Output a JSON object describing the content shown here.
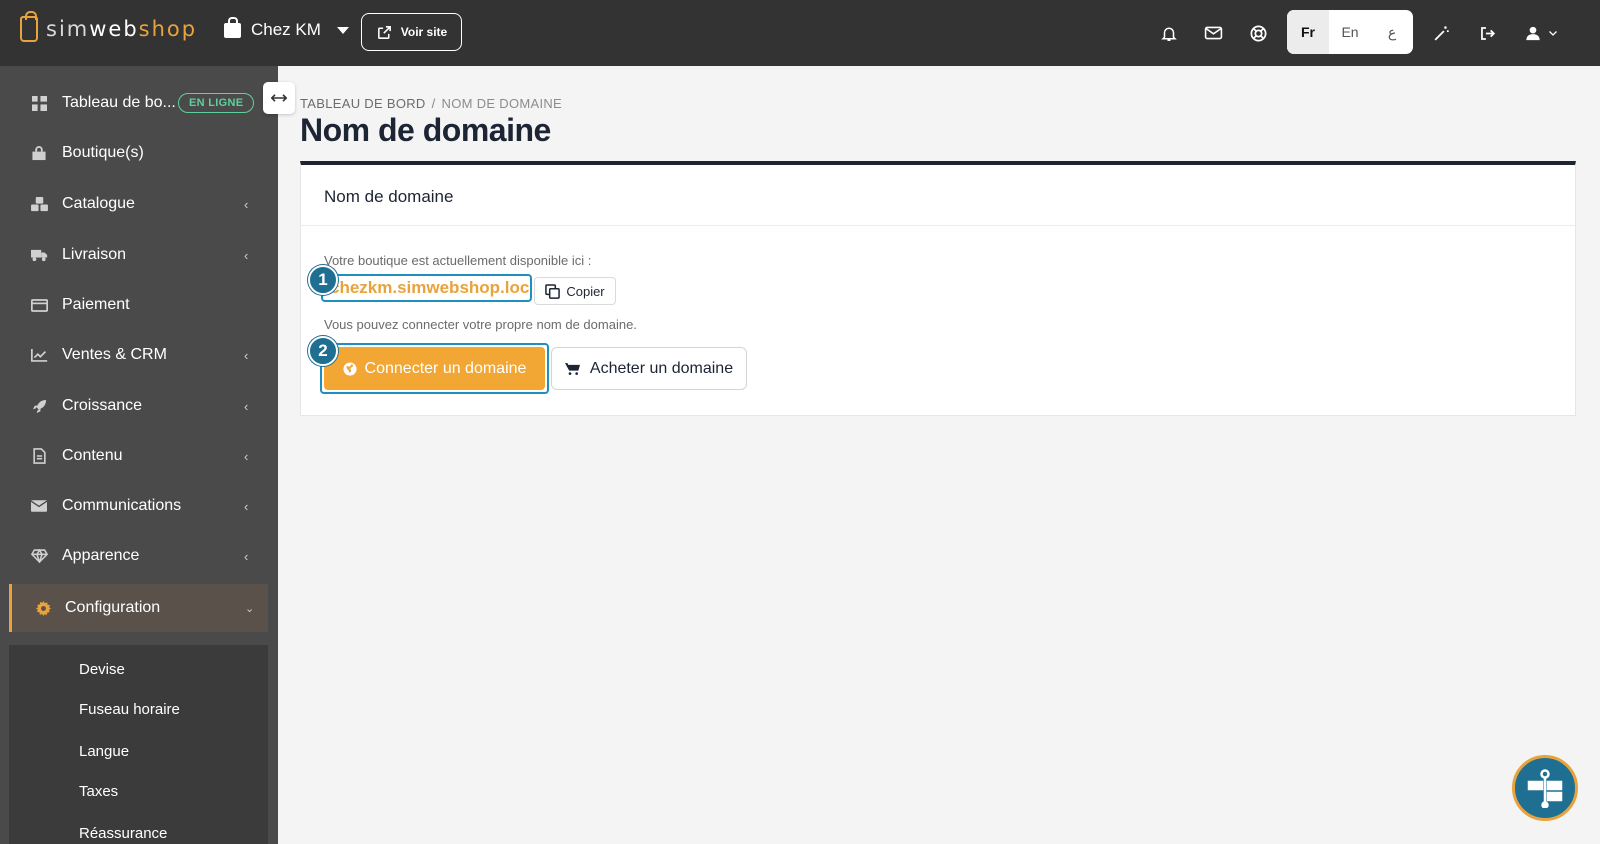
{
  "brand": {
    "logo_pre": "sim",
    "logo_mid": "web",
    "logo_post": "shop"
  },
  "header": {
    "shop_name": "Chez KM",
    "view_site_label": "Voir site",
    "languages": [
      {
        "code": "Fr",
        "active": true
      },
      {
        "code": "En",
        "active": false
      },
      {
        "code": "ع",
        "active": false
      }
    ],
    "icons": [
      "bell-icon",
      "mail-icon",
      "support-icon",
      "magic-wand-icon",
      "logout-icon",
      "user-icon"
    ]
  },
  "sidebar": {
    "items": [
      {
        "label": "Tableau de bo...",
        "icon": "dashboard-icon",
        "badge": "EN LIGNE"
      },
      {
        "label": "Boutique(s)",
        "icon": "store-icon"
      },
      {
        "label": "Catalogue",
        "icon": "catalog-icon",
        "has_children": true
      },
      {
        "label": "Livraison",
        "icon": "truck-icon",
        "has_children": true
      },
      {
        "label": "Paiement",
        "icon": "credit-card-icon"
      },
      {
        "label": "Ventes & CRM",
        "icon": "chart-icon",
        "has_children": true
      },
      {
        "label": "Croissance",
        "icon": "rocket-icon",
        "has_children": true
      },
      {
        "label": "Contenu",
        "icon": "document-icon",
        "has_children": true
      },
      {
        "label": "Communications",
        "icon": "envelope-icon",
        "has_children": true
      },
      {
        "label": "Apparence",
        "icon": "diamond-icon",
        "has_children": true
      },
      {
        "label": "Configuration",
        "icon": "gear-icon",
        "has_children": true,
        "active": true
      }
    ],
    "subitems": [
      "Devise",
      "Fuseau horaire",
      "Langue",
      "Taxes",
      "Réassurance"
    ]
  },
  "breadcrumb": {
    "root": "TABLEAU DE BORD",
    "separator": "/",
    "current": "NOM DE DOMAINE"
  },
  "page": {
    "title": "Nom de domaine"
  },
  "card": {
    "title": "Nom de domaine",
    "available_text": "Votre boutique est actuellement disponible ici :",
    "domain_value": "chezkm.simwebshop.loc",
    "copy_label": "Copier",
    "own_domain_text": "Vous pouvez connecter votre propre nom de domaine.",
    "connect_label": "Connecter un domaine",
    "buy_label": "Acheter un domaine"
  },
  "steps": [
    "1",
    "2"
  ],
  "colors": {
    "accent": "#e8a33d",
    "button_orange": "#f2a633",
    "highlight_blue": "#1f8fc0",
    "sidebar": "#4a4a4a",
    "topbar": "#333333"
  }
}
